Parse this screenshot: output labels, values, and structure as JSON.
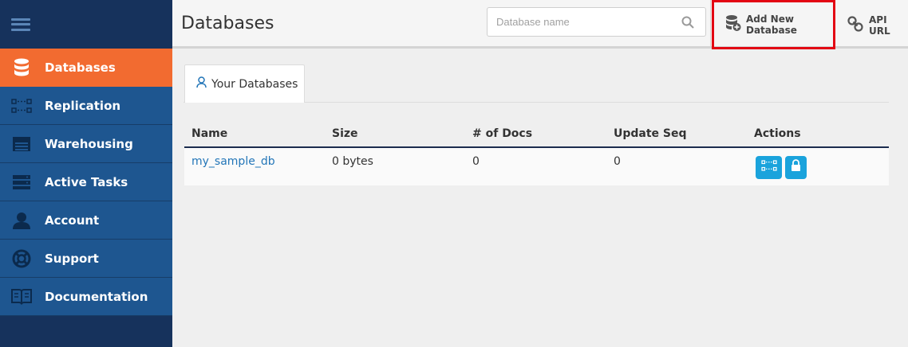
{
  "sidebar": {
    "items": [
      {
        "label": "Databases",
        "icon": "database-icon",
        "active": true
      },
      {
        "label": "Replication",
        "icon": "replication-icon",
        "active": false
      },
      {
        "label": "Warehousing",
        "icon": "warehouse-icon",
        "active": false
      },
      {
        "label": "Active Tasks",
        "icon": "tasks-icon",
        "active": false
      },
      {
        "label": "Account",
        "icon": "account-icon",
        "active": false
      },
      {
        "label": "Support",
        "icon": "lifebuoy-icon",
        "active": false
      },
      {
        "label": "Documentation",
        "icon": "book-icon",
        "active": false
      }
    ],
    "colors": {
      "background": "#16325c",
      "item": "#1e5690",
      "active": "#f26b30"
    }
  },
  "header": {
    "title": "Databases",
    "search_placeholder": "Database name",
    "add_database_label": "Add New Database",
    "api_url_label": "API URL"
  },
  "tabs": [
    {
      "label": "Your Databases",
      "icon": "user-icon"
    }
  ],
  "table": {
    "columns": [
      "Name",
      "Size",
      "# of Docs",
      "Update Seq",
      "Actions"
    ],
    "rows": [
      {
        "name": "my_sample_db",
        "size": "0 bytes",
        "docs": "0",
        "update_seq": "0",
        "actions": [
          "replicate-icon",
          "lock-icon"
        ]
      }
    ]
  },
  "colors": {
    "accent": "#1aa3dc",
    "link": "#2376b8",
    "highlight_border": "#e30613"
  }
}
